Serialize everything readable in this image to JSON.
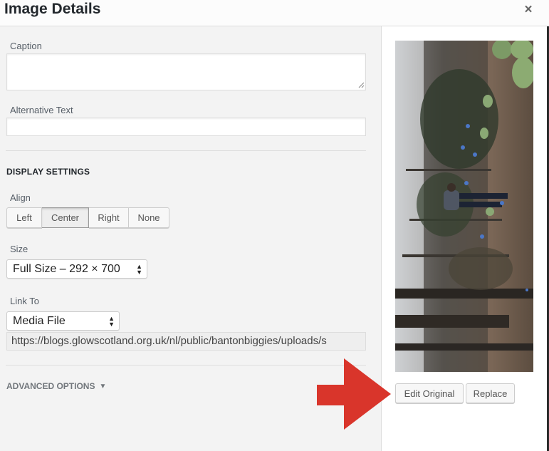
{
  "header": {
    "title": "Image Details",
    "close_glyph": "×"
  },
  "caption": {
    "label": "Caption",
    "value": ""
  },
  "alt_text": {
    "label": "Alternative Text",
    "value": ""
  },
  "display_settings": {
    "title": "Display Settings",
    "align": {
      "label": "Align",
      "options": [
        "Left",
        "Center",
        "Right",
        "None"
      ],
      "selected": "Center"
    },
    "size": {
      "label": "Size",
      "selected": "Full Size – 292 × 700"
    },
    "link_to": {
      "label": "Link To",
      "selected": "Media File",
      "url": "https://blogs.glowscotland.org.uk/nl/public/bantonbiggies/uploads/s"
    }
  },
  "advanced": {
    "label": "Advanced Options"
  },
  "actions": {
    "edit_original": "Edit Original",
    "replace": "Replace"
  },
  "colors": {
    "annotation_arrow": "#d9352b"
  },
  "icons": {
    "close": "close-icon",
    "select_arrows": "select-arrows-icon",
    "caret": "caret-down-icon",
    "resize": "resize-handle-icon",
    "annotation": "arrow-right-icon"
  }
}
